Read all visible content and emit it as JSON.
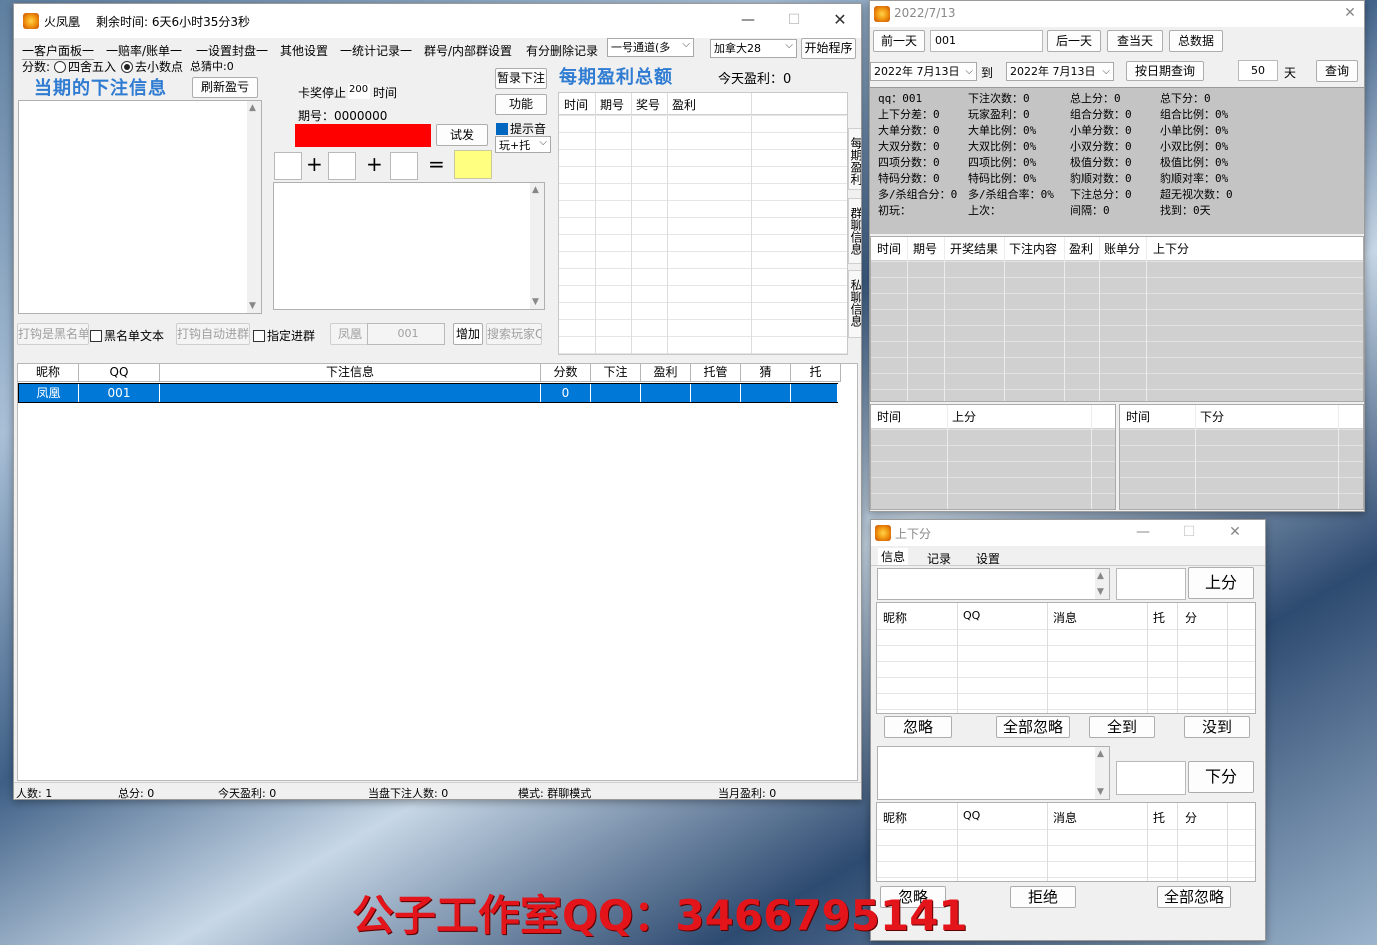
{
  "main": {
    "title": "火凤凰",
    "remaining": "剩余时间: 6天6小时35分3秒",
    "tabs": [
      "一客户面板一",
      "一赔率/账单一",
      "一设置封盘一",
      "其他设置",
      "一统计记录一",
      "群号/内部群设置",
      "有分删除记录"
    ],
    "channel_combo": "一号通道(多",
    "region_combo": "加拿大28",
    "start_button": "开始程序",
    "score_label": "分数:",
    "round_option": "四舍五入",
    "decimal_option": "去小数点",
    "total_guess": "总猜中:0",
    "current_bet_title": "当期的下注信息",
    "refresh_button": "刷新盈亏",
    "stop_label": "卡奖停止",
    "stop_value": "200",
    "stop_unit": "时间",
    "issue_label": "期号：0000000",
    "trial_button": "试发",
    "pause_button": "暂录下注",
    "function_button": "功能",
    "sound_check": "提示音",
    "play_combo": "玩+托",
    "plus1": "+",
    "plus2": "+",
    "equals": "=",
    "profit_title": "每期盈利总额",
    "today_profit": "今天盈利：0",
    "profit_cols": [
      "时间",
      "期号",
      "奖号",
      "盈利"
    ],
    "vtabs": [
      "每期盈利",
      "群聊信息",
      "私聊信息"
    ],
    "blacklist_btn": "打钩是黑名单",
    "blacklist_text": "黑名单文本",
    "auto_group_btn": "打钩自动进群",
    "designated_group": "指定进群",
    "name_input": "凤凰",
    "qq_input": "001",
    "add_button": "增加",
    "search_input": "搜索玩家Q",
    "table_headers": [
      "昵称",
      "QQ",
      "下注信息",
      "分数",
      "下注",
      "盈利",
      "托管",
      "猜",
      "托"
    ],
    "table_row": {
      "nick": "凤凰",
      "qq": "001",
      "bet": "",
      "score": "0"
    },
    "status": {
      "players": "人数: 1",
      "total": "总分: 0",
      "today": "今天盈利: 0",
      "current_count": "当盘下注人数: 0",
      "mode": "模式: 群聊模式",
      "month": "当月盈利: 0"
    }
  },
  "stats": {
    "title": "2022/7/13",
    "prev_day": "前一天",
    "qq_value": "001",
    "next_day": "后一天",
    "today_btn": "查当天",
    "total_btn": "总数据",
    "date_from": "2022年 7月13日",
    "to_label": "到",
    "date_to": "2022年 7月13日",
    "date_query": "按日期查询",
    "days_value": "50",
    "days_unit": "天",
    "query_btn": "查询",
    "rows": [
      [
        "qq：001",
        "下注次数：0",
        "总上分：0",
        "总下分：0"
      ],
      [
        "上下分差：0",
        "玩家盈利：0",
        "组合分数：0",
        "组合比例：0%"
      ],
      [
        "大单分数：0",
        "大单比例：0%",
        "小单分数：0",
        "小单比例：0%"
      ],
      [
        "大双分数：0",
        "大双比例：0%",
        "小双分数：0",
        "小双比例：0%"
      ],
      [
        "四项分数：0",
        "四项比例：0%",
        "极值分数：0",
        "极值比例：0%"
      ],
      [
        "特码分数：0",
        "特码比例：0%",
        "豹顺对数：0",
        "豹顺对率：0%"
      ],
      [
        "多/杀组合分：0",
        "多/杀组合率：0%",
        "下注总分：0",
        "超无视次数：0"
      ],
      [
        "初玩：",
        "上次：",
        "间隔：0",
        "找到：0天"
      ]
    ],
    "detail_cols": [
      "时间",
      "期号",
      "开奖结果",
      "下注内容",
      "盈利",
      "账单分",
      "上下分"
    ],
    "up_cols": [
      "时间",
      "上分"
    ],
    "down_cols": [
      "时间",
      "下分"
    ]
  },
  "updown": {
    "title": "上下分",
    "tabs": [
      "信息",
      "记录",
      "设置"
    ],
    "up_button": "上分",
    "down_button": "下分",
    "cols": [
      "昵称",
      "QQ",
      "消息",
      "托",
      "分"
    ],
    "ignore": "忽略",
    "ignore_all": "全部忽略",
    "all_arrive": "全到",
    "not_arrive": "没到",
    "ignore2": "忽略",
    "reject": "拒绝",
    "ignore_all2": "全部忽略"
  },
  "watermark": "公子工作室QQ：3466795141",
  "colors": {
    "accent": "#0078d7",
    "title_blue": "#2f7cd2",
    "red_box": "#ff0000",
    "yellow_box": "#ffff80",
    "watermark": "#e4141b"
  }
}
